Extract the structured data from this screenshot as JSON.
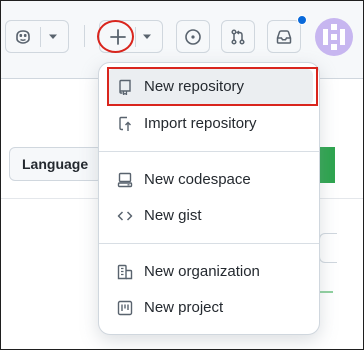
{
  "header": {
    "copilot_icon": "copilot-icon",
    "create_icon": "plus-icon",
    "issues_icon": "issue-opened-icon",
    "pulls_icon": "git-pull-request-icon",
    "inbox_icon": "inbox-icon",
    "notification_color": "#0969da"
  },
  "background": {
    "language_label": "Language"
  },
  "create_menu": {
    "items": [
      {
        "label": "New repository",
        "icon": "repo-icon"
      },
      {
        "label": "Import repository",
        "icon": "repo-push-icon"
      },
      {
        "label": "New codespace",
        "icon": "codespaces-icon"
      },
      {
        "label": "New gist",
        "icon": "code-icon"
      },
      {
        "label": "New organization",
        "icon": "organization-icon"
      },
      {
        "label": "New project",
        "icon": "project-icon"
      }
    ]
  },
  "colors": {
    "annotation_red": "#d9251d",
    "accent_green": "#2da44e",
    "text": "#24292f",
    "icon": "#59636e"
  }
}
